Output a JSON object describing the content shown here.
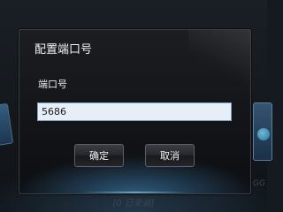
{
  "background": {
    "caption": "[0 已安装]",
    "caption_right": "GG"
  },
  "dialog": {
    "title": "配置端口号",
    "field_label": "端口号",
    "port_value": "5686",
    "ok_label": "确定",
    "cancel_label": "取消"
  },
  "colors": {
    "dialog_bg": "#111316",
    "input_bg": "#e6eef8",
    "input_border": "#7fa2c4",
    "accent_glow": "#aee1ff"
  }
}
